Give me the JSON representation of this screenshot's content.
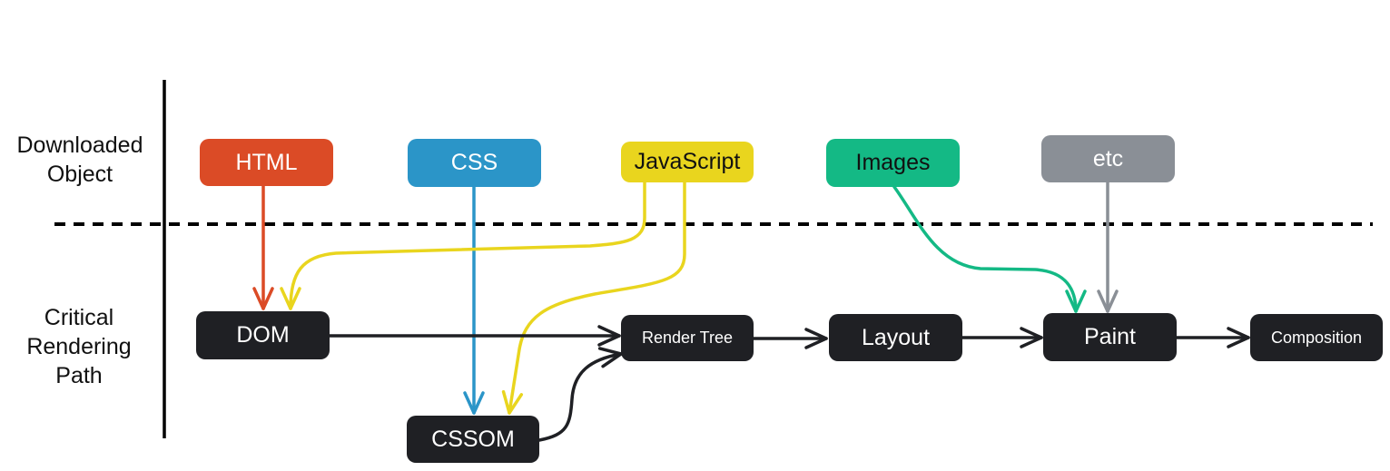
{
  "labels": {
    "downloaded": [
      "Downloaded",
      "Object"
    ],
    "critical": [
      "Critical",
      "Rendering",
      "Path"
    ]
  },
  "nodes": {
    "html": {
      "label": "HTML",
      "color": "#DB4B26"
    },
    "css": {
      "label": "CSS",
      "color": "#2B95C8"
    },
    "javascript": {
      "label": "JavaScript",
      "color": "#E9D51E"
    },
    "images": {
      "label": "Images",
      "color": "#14B985"
    },
    "etc": {
      "label": "etc",
      "color": "#8A8F96"
    },
    "dom": {
      "label": "DOM",
      "color": "#1F2024"
    },
    "cssom": {
      "label": "CSSOM",
      "color": "#1F2024"
    },
    "render_tree": {
      "label": "Render Tree",
      "color": "#1F2024"
    },
    "layout": {
      "label": "Layout",
      "color": "#1F2024"
    },
    "paint": {
      "label": "Paint",
      "color": "#1F2024"
    },
    "composition": {
      "label": "Composition",
      "color": "#1F2024"
    }
  },
  "edges": [
    {
      "from": "html",
      "to": "dom"
    },
    {
      "from": "css",
      "to": "cssom"
    },
    {
      "from": "javascript",
      "to": "dom"
    },
    {
      "from": "javascript",
      "to": "cssom"
    },
    {
      "from": "images",
      "to": "paint"
    },
    {
      "from": "etc",
      "to": "paint"
    },
    {
      "from": "dom",
      "to": "render_tree"
    },
    {
      "from": "cssom",
      "to": "render_tree"
    },
    {
      "from": "render_tree",
      "to": "layout"
    },
    {
      "from": "layout",
      "to": "paint"
    },
    {
      "from": "paint",
      "to": "composition"
    }
  ]
}
